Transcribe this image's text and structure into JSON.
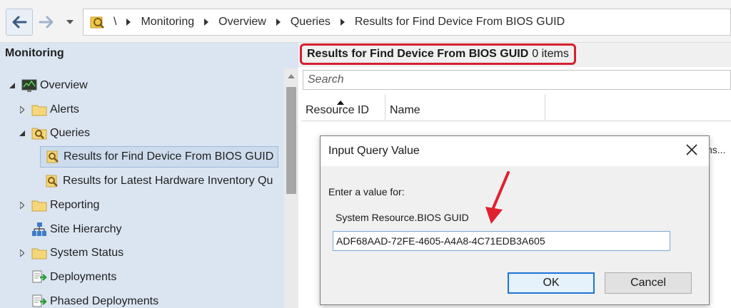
{
  "breadcrumb": {
    "items": [
      "\\",
      "Monitoring",
      "Overview",
      "Queries",
      "Results for Find Device From BIOS GUID"
    ]
  },
  "nav": {
    "title": "Monitoring",
    "items": [
      {
        "label": "Overview",
        "icon": "overview-monitor-icon",
        "expanded": true
      },
      {
        "label": "Alerts",
        "icon": "folder-icon"
      },
      {
        "label": "Queries",
        "icon": "queries-folder-icon",
        "expanded": true
      },
      {
        "label": "Results for Find Device From BIOS GUID",
        "icon": "query-result-icon",
        "selected": true
      },
      {
        "label": "Results for Latest Hardware Inventory Qu",
        "icon": "query-result-icon"
      },
      {
        "label": "Reporting",
        "icon": "folder-icon"
      },
      {
        "label": "Site Hierarchy",
        "icon": "site-hierarchy-icon"
      },
      {
        "label": "System Status",
        "icon": "folder-icon"
      },
      {
        "label": "Deployments",
        "icon": "deployments-icon"
      },
      {
        "label": "Phased Deployments",
        "icon": "deployments-icon"
      }
    ]
  },
  "results": {
    "title": "Results for Find Device From BIOS GUID",
    "count": "0 items",
    "search_placeholder": "Search",
    "columns": [
      "Resource ID",
      "Name"
    ],
    "hidden_text": "ns..."
  },
  "dialog": {
    "title": "Input Query Value",
    "prompt": "Enter a value for:",
    "field_label": "System Resource.BIOS GUID",
    "field_value": "ADF68AAD-72FE-4605-A4A8-4C71EDB3A605",
    "ok_label": "OK",
    "cancel_label": "Cancel"
  },
  "colors": {
    "highlight": "#d6202f",
    "nav_bg": "#dbe5f1",
    "selection": "#cddced"
  }
}
